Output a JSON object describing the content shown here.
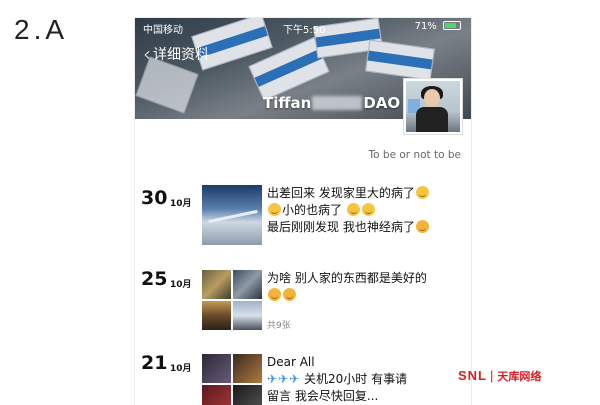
{
  "slide_label": "2.A",
  "status_bar": {
    "carrier": "中国移动",
    "time": "下午5:50",
    "battery": "71%"
  },
  "nav": {
    "back_label": "详细资料"
  },
  "profile": {
    "name_prefix": "Tiffan",
    "name_suffix": "DAO",
    "signature": "To be or not to be"
  },
  "posts": [
    {
      "day": "30",
      "month": "10月",
      "lines": [
        "出差回来 发现家里大的病了",
        "小的也病了",
        "最后刚刚发现 我也神经病了"
      ]
    },
    {
      "day": "25",
      "month": "10月",
      "lines": [
        "为啥 别人家的东西都是美好的"
      ],
      "photo_count": "共9张"
    },
    {
      "day": "21",
      "month": "10月",
      "lines": [
        "Dear All",
        "关机20小时 有事请",
        "留言 我会尽快回复..."
      ]
    }
  ],
  "watermark": {
    "brand": "SNL",
    "sep": "|",
    "site": "天库网络",
    "color": "#d81e24"
  }
}
